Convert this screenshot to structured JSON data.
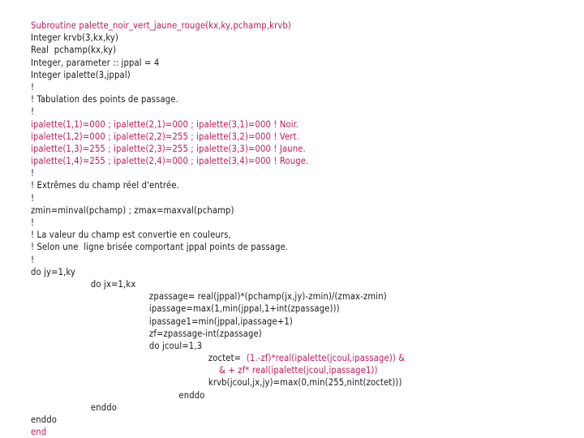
{
  "document": {
    "kind": "fortran-source-slide",
    "background_color": "#ffffff",
    "text_color": "#1a1a1a",
    "highlight_color": "#c2185b",
    "routine_name": "palette_noir_vert_jaune_rouge"
  },
  "code": {
    "lines": [
      {
        "text": "Subroutine palette_noir_vert_jaune_rouge(kx,ky,pchamp,krvb)",
        "color": "pink",
        "indent": 0
      },
      {
        "text": "Integer krvb(3,kx,ky)",
        "color": "black",
        "indent": 0
      },
      {
        "text": "Real  pchamp(kx,ky)",
        "color": "black",
        "indent": 0
      },
      {
        "text": "Integer, parameter :: jppal = 4",
        "color": "black",
        "indent": 0
      },
      {
        "text": "Integer ipalette(3,jppal)",
        "color": "black",
        "indent": 0
      },
      {
        "text": "!",
        "color": "black",
        "indent": 0
      },
      {
        "text": "! Tabulation des points de passage.",
        "color": "black",
        "indent": 0
      },
      {
        "text": "!",
        "color": "black",
        "indent": 0
      },
      {
        "text": "ipalette(1,1)=000 ; ipalette(2,1)=000 ; ipalette(3,1)=000 ! Noir.",
        "color": "pink",
        "indent": 0
      },
      {
        "text": "ipalette(1,2)=000 ; ipalette(2,2)=255 ; ipalette(3,2)=000 ! Vert.",
        "color": "pink",
        "indent": 0
      },
      {
        "text": "ipalette(1,3)=255 ; ipalette(2,3)=255 ; ipalette(3,3)=000 ! Jaune.",
        "color": "pink",
        "indent": 0
      },
      {
        "text": "ipalette(1,4)=255 ; ipalette(2,4)=000 ; ipalette(3,4)=000 ! Rouge.",
        "color": "pink",
        "indent": 0
      },
      {
        "text": "!",
        "color": "black",
        "indent": 0
      },
      {
        "text": "! Extrêmes du champ réel d'entrée.",
        "color": "black",
        "indent": 0
      },
      {
        "text": "!",
        "color": "black",
        "indent": 0
      },
      {
        "text": "zmin=minval(pchamp) ; zmax=maxval(pchamp)",
        "color": "black",
        "indent": 0
      },
      {
        "text": "!",
        "color": "black",
        "indent": 0
      },
      {
        "text": "! La valeur du champ est convertie en couleurs,",
        "color": "black",
        "indent": 0
      },
      {
        "text": "! Selon une  ligne brisée comportant jppal points de passage.",
        "color": "black",
        "indent": 0
      },
      {
        "text": "!",
        "color": "black",
        "indent": 0
      },
      {
        "text": "do jy=1,ky",
        "color": "black",
        "indent": 0
      },
      {
        "text": "do jx=1,kx",
        "color": "black",
        "indent": 1
      },
      {
        "text": "zpassage= real(jppal)*(pchamp(jx,jy)-zmin)/(zmax-zmin)",
        "color": "black",
        "indent": 2
      },
      {
        "text": "ipassage=max(1,min(jppal,1+int(zpassage)))",
        "color": "black",
        "indent": 2
      },
      {
        "text": "ipassage1=min(jppal,ipassage+1)",
        "color": "black",
        "indent": 2
      },
      {
        "text": "zf=zpassage-int(zpassage)",
        "color": "black",
        "indent": 2
      },
      {
        "text": "do jcoul=1,3",
        "color": "black",
        "indent": 2
      },
      {
        "head": "zoctet=",
        "tail": "  (1.-zf)*real(ipalette(jcoul,ipassage)) &",
        "color": "mixed",
        "indent": 4
      },
      {
        "head": "",
        "tail": "    & + zf* real(ipalette(jcoul,ipassage1))",
        "color": "mixed",
        "indent": 4
      },
      {
        "text": "krvb(jcoul,jx,jy)=max(0,min(255,nint(zoctet)))",
        "color": "black",
        "indent": 4
      },
      {
        "text": "enddo",
        "color": "black",
        "indent": 3
      },
      {
        "text": "enddo",
        "color": "black",
        "indent": 1
      },
      {
        "text": "enddo",
        "color": "black",
        "indent": 0
      },
      {
        "text": "end",
        "color": "pink",
        "indent": 0
      }
    ]
  }
}
